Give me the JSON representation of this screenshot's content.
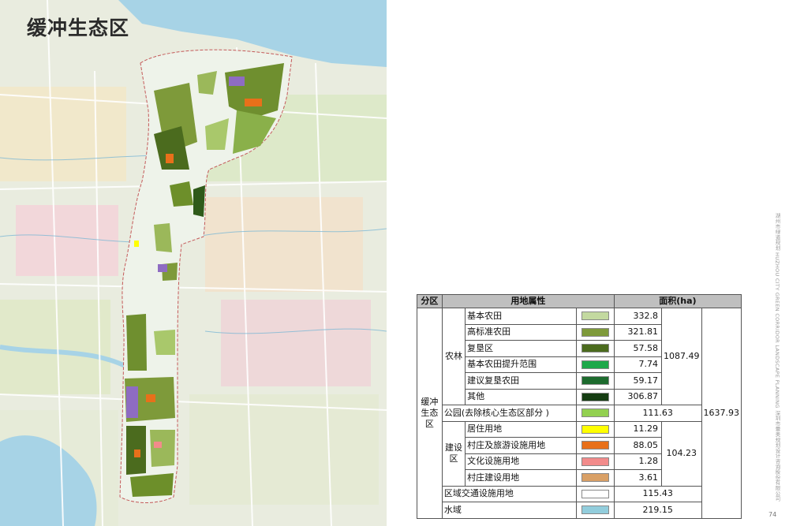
{
  "map": {
    "title": "缓冲生态区"
  },
  "table": {
    "headers": {
      "zone": "分区",
      "attribute": "用地属性",
      "area": "面积(ha)"
    },
    "zone_label": "缓冲\n生态\n区",
    "total": "1637.93",
    "agri": {
      "category": "农林",
      "subtotal": "1087.49",
      "rows": [
        {
          "name": "基本农田",
          "value": "332.8",
          "color": "#c3d9a0"
        },
        {
          "name": "高标准农田",
          "value": "321.81",
          "color": "#7e9a3a"
        },
        {
          "name": "复垦区",
          "value": "57.58",
          "color": "#4b6b1e"
        },
        {
          "name": "基本农田提升范围",
          "value": "7.74",
          "color": "#1ea84a"
        },
        {
          "name": "建议复垦农田",
          "value": "59.17",
          "color": "#1d6b2e"
        },
        {
          "name": "其他",
          "value": "306.87",
          "color": "#153d12"
        }
      ]
    },
    "park": {
      "name": "公园(去除核心生态区部分 )",
      "value": "111.63",
      "color": "#92d050"
    },
    "construction": {
      "category": "建设\n区",
      "subtotal": "104.23",
      "rows": [
        {
          "name": "居住用地",
          "value": "11.29",
          "color": "#ffff00"
        },
        {
          "name": "村庄及旅游设施用地",
          "value": "88.05",
          "color": "#e8701a"
        },
        {
          "name": "文化设施用地",
          "value": "1.28",
          "color": "#f28b8b"
        },
        {
          "name": "村庄建设用地",
          "value": "3.61",
          "color": "#d9a066"
        }
      ]
    },
    "transport": {
      "name": "区域交通设施用地",
      "value": "115.43",
      "color": "#ffffff"
    },
    "water": {
      "name": "水域",
      "value": "219.15",
      "color": "#92cddc"
    }
  },
  "side_text": "湖州市绿道规划 HUZHOU CITY GREEN CORRIDOR LANDSCAPE PLANNING  深圳市蕾奥规划设计咨询股份有限公司",
  "page_number": "74"
}
